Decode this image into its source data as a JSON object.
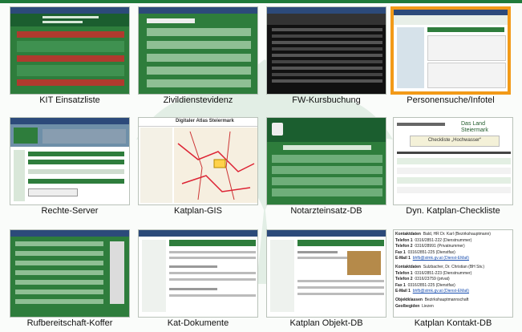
{
  "page": {
    "accent_color": "#1f7a3a",
    "selection_color": "#f29a18"
  },
  "thumbnails": [
    {
      "caption": "KIT Einsatzliste",
      "theme": "green-table",
      "selected": false
    },
    {
      "caption": "Zivildienstevidenz",
      "theme": "green-form",
      "selected": false
    },
    {
      "caption": "FW-Kursbuchung",
      "theme": "dark-list",
      "selected": false
    },
    {
      "caption": "Personensuche/Infotel",
      "theme": "light-portal",
      "selected": true
    },
    {
      "caption": "Rechte-Server",
      "theme": "rights",
      "selected": false
    },
    {
      "caption": "Katplan-GIS",
      "theme": "map",
      "selected": false,
      "title": "Digitaler Atlas Steiermark"
    },
    {
      "caption": "Notarzteinsatz-DB",
      "theme": "green-form2",
      "selected": false
    },
    {
      "caption": "Dyn. Katplan-Checkliste",
      "theme": "checklist",
      "selected": false,
      "logo": "Das Land Steiermark",
      "heading": "Checkliste „Hochwasser“"
    },
    {
      "caption": "Rufbereitschaft-Koffer",
      "theme": "green-list",
      "selected": false
    },
    {
      "caption": "Kat-Dokumente",
      "theme": "docs",
      "selected": false
    },
    {
      "caption": "Katplan Objekt-DB",
      "theme": "object",
      "selected": false
    },
    {
      "caption": "Katplan Kontakt-DB",
      "theme": "contact",
      "selected": false,
      "contact": {
        "rows": [
          {
            "label": "Kontaktdaten",
            "value": "Bald, HR Dr. Karl (Bezirkshauptmann)"
          },
          {
            "label": "Telefon 1",
            "value": "0316/2851-222 (Dienstnummer)"
          },
          {
            "label": "Telefon 2",
            "value": "0316/28991 (Privatnummer)"
          },
          {
            "label": "Fax 1",
            "value": "0316/2851-225 (Dienstfax)"
          },
          {
            "label": "E-Mail 1",
            "value": "bhfb@stmk.gv.at (Dienst-EMail)"
          },
          {
            "label": "Kontaktdaten",
            "value": "Sulzbacher, Dr. Christian (BH Stv.)"
          },
          {
            "label": "Telefon 1",
            "value": "0316/2851-223 (Dienstnummer)"
          },
          {
            "label": "Telefon 2",
            "value": "0316/23759 (privat)"
          },
          {
            "label": "Fax 1",
            "value": "0316/2851-225 (Dienstfax)"
          },
          {
            "label": "E-Mail 1",
            "value": "bhfb@stmk.gv.at (Dienst-EMail)"
          },
          {
            "label": "Objektklassen",
            "value": "Bezirkshauptmannschaft"
          },
          {
            "label": "Geolbegiden",
            "value": "Liezen"
          }
        ]
      }
    }
  ]
}
